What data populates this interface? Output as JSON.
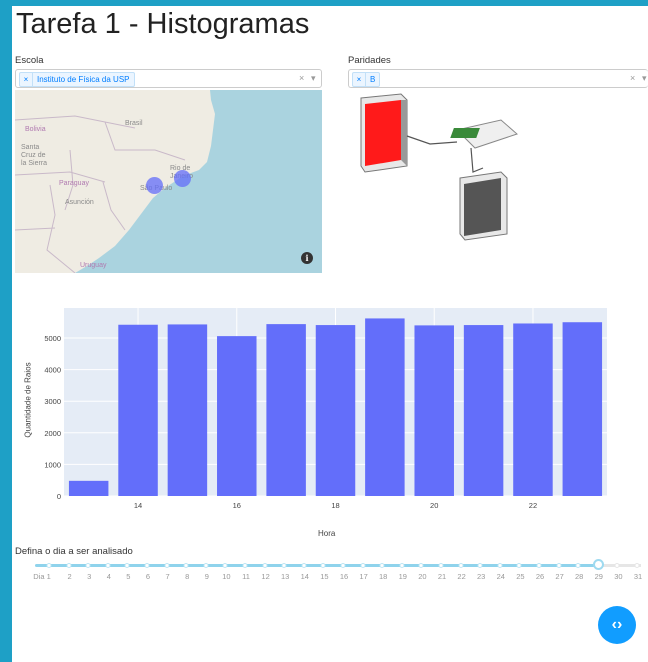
{
  "page": {
    "title": "Tarefa 1 - Histogramas"
  },
  "escola": {
    "label": "Escola",
    "selected": "Instituto de Física da USP",
    "chip_remove": "×",
    "clear": "×",
    "arrow": "▾"
  },
  "paridades": {
    "label": "Paridades",
    "selected": "B",
    "chip_remove": "×",
    "clear": "×",
    "arrow": "▾"
  },
  "map": {
    "labels": {
      "brasil": "Brasil",
      "bolivia": "Bolivia",
      "santa_cruz": "Santa\nCruz de\nla Sierra",
      "paraguay": "Paraguay",
      "asuncion": "Asunción",
      "rio": "Rio de\nJaneiro",
      "sao_paulo": "São Paulo",
      "uruguay": "Uruguay"
    },
    "info_icon": "i",
    "marker_color": "#636efa"
  },
  "chart_data": {
    "type": "bar",
    "categories": [
      13,
      14,
      15,
      16,
      17,
      18,
      19,
      20,
      21,
      22,
      23
    ],
    "values": [
      480,
      5420,
      5430,
      5060,
      5440,
      5410,
      5620,
      5400,
      5410,
      5460,
      5500
    ],
    "xlabel": "Hora",
    "ylabel": "Quantidade de Raios",
    "xticks": [
      14,
      16,
      18,
      20,
      22
    ],
    "yticks": [
      0,
      1000,
      2000,
      3000,
      4000,
      5000
    ],
    "ylim": [
      0,
      5950
    ],
    "grid": true,
    "bar_color": "#636efa",
    "plot_bg": "#e5ecf6"
  },
  "slider": {
    "label": "Defina o dia a ser analisado",
    "marks": [
      "Dia 1",
      "2",
      "3",
      "4",
      "5",
      "6",
      "7",
      "8",
      "9",
      "10",
      "11",
      "12",
      "13",
      "14",
      "15",
      "16",
      "17",
      "18",
      "19",
      "20",
      "21",
      "22",
      "23",
      "24",
      "25",
      "26",
      "27",
      "28",
      "29",
      "30",
      "31"
    ],
    "value": 29
  },
  "fab": {
    "icon": "code-icon",
    "glyph": "‹›"
  }
}
